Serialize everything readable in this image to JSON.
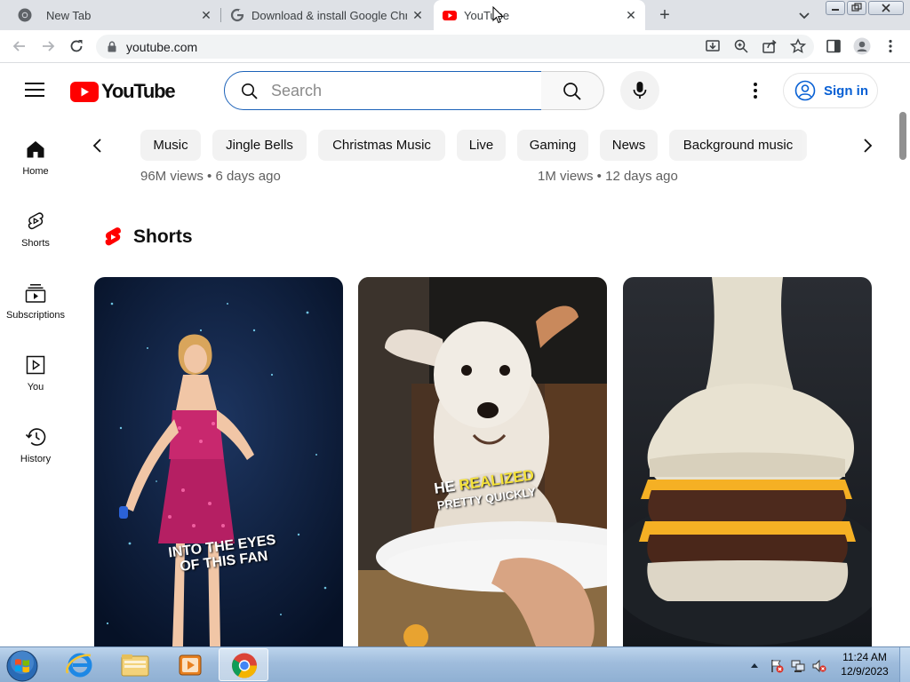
{
  "browser": {
    "tabs": [
      {
        "title": "New Tab",
        "icon": "chrome-icon",
        "active": false
      },
      {
        "title": "Download & install Google Chrom",
        "icon": "google-icon",
        "active": false
      },
      {
        "title": "YouTube",
        "icon": "youtube-icon",
        "active": true
      }
    ],
    "url": "youtube.com"
  },
  "youtube": {
    "logo_text": "YouTube",
    "search_placeholder": "Search",
    "signin_label": "Sign in",
    "guide": [
      {
        "label": "Home",
        "icon": "home-icon"
      },
      {
        "label": "Shorts",
        "icon": "shorts-icon"
      },
      {
        "label": "Subscriptions",
        "icon": "subscriptions-icon"
      },
      {
        "label": "You",
        "icon": "you-icon"
      },
      {
        "label": "History",
        "icon": "history-icon"
      }
    ],
    "chips": [
      "Music",
      "Jingle Bells",
      "Christmas Music",
      "Live",
      "Gaming",
      "News",
      "Background music"
    ],
    "video_meta": [
      "96M views • 6 days ago",
      "1M views • 12 days ago"
    ],
    "shorts_title": "Shorts",
    "shorts": [
      {
        "caption_line1": "INTO THE EYES",
        "caption_line2": "OF THIS FAN"
      },
      {
        "caption_line1a": "HE",
        "caption_line1b": "REALIZED",
        "caption_line2": "PRETTY QUICKLY"
      },
      {
        "caption_line1": "",
        "caption_line2": ""
      }
    ]
  },
  "taskbar": {
    "time": "11:24 AM",
    "date": "12/9/2023"
  },
  "colors": {
    "youtube_red": "#ff0000",
    "link_blue": "#065fd4",
    "search_focus": "#1c62b9",
    "chip_bg": "#f2f2f2"
  }
}
